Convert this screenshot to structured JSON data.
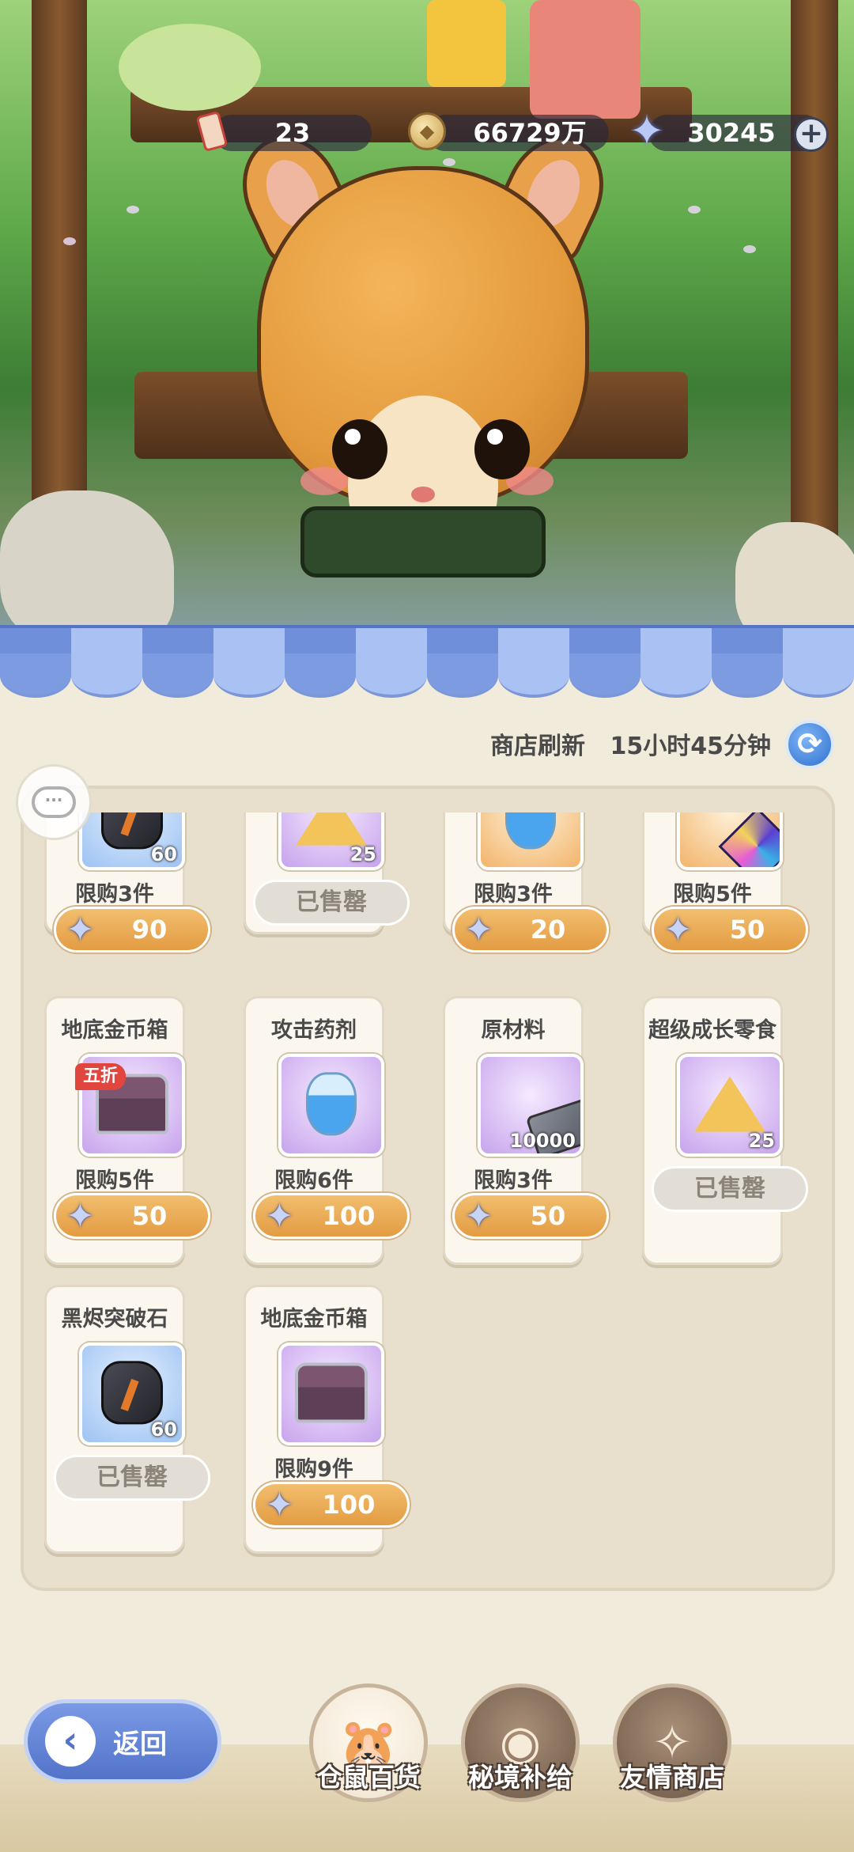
{
  "currencies": {
    "tickets": "23",
    "gold": "66729万",
    "stars": "30245",
    "add_icon": "plus-icon"
  },
  "shop": {
    "refresh_label": "商店刷新",
    "refresh_time": "15小时45分钟",
    "refresh_icon": "refresh-icon",
    "chat_icon": "chat-bubble-icon"
  },
  "items": [
    {
      "name": "",
      "icon": "black-ore-icon",
      "frame": "blue",
      "qty": "60",
      "limit": "限购3件",
      "price": "90",
      "sold_out": false
    },
    {
      "name": "",
      "icon": "cheese-icon",
      "frame": "purple",
      "qty": "25",
      "limit": "",
      "price": "",
      "sold_out": true,
      "sold_label": "已售罄"
    },
    {
      "name": "",
      "icon": "potion-icon",
      "frame": "orange",
      "qty": "",
      "limit": "限购3件",
      "price": "20",
      "sold_out": false
    },
    {
      "name": "",
      "icon": "gem-icon",
      "frame": "orange",
      "qty": "",
      "limit": "限购5件",
      "price": "50",
      "sold_out": false
    },
    {
      "name": "地底金币箱",
      "icon": "treasure-chest-icon",
      "frame": "purple",
      "qty": "",
      "badge": "五折",
      "limit": "限购5件",
      "price": "50",
      "sold_out": false
    },
    {
      "name": "攻击药剂",
      "icon": "potion-icon",
      "frame": "purple",
      "qty": "",
      "limit": "限购6件",
      "price": "100",
      "sold_out": false
    },
    {
      "name": "原材料",
      "icon": "ingot-icon",
      "frame": "purple",
      "qty": "10000",
      "limit": "限购3件",
      "price": "50",
      "sold_out": false
    },
    {
      "name": "超级成长零食",
      "icon": "cheese-icon",
      "frame": "purple",
      "qty": "25",
      "limit": "",
      "price": "",
      "sold_out": true,
      "sold_label": "已售罄"
    },
    {
      "name": "黑烬突破石",
      "icon": "black-ore-icon",
      "frame": "blue",
      "qty": "60",
      "limit": "",
      "price": "",
      "sold_out": true,
      "sold_label": "已售罄"
    },
    {
      "name": "地底金币箱",
      "icon": "treasure-chest-icon",
      "frame": "purple",
      "qty": "",
      "limit": "限购9件",
      "price": "100",
      "sold_out": false
    }
  ],
  "nav": {
    "back_label": "返回",
    "tabs": [
      {
        "label": "仓鼠百货",
        "icon": "hamster-icon",
        "active": true
      },
      {
        "label": "秘境补给",
        "icon": "eye-emblem-icon",
        "active": false
      },
      {
        "label": "友情商店",
        "icon": "crystal-ball-icon",
        "active": false
      }
    ]
  },
  "colors": {
    "price_button": "#e39c43",
    "awning_blue": "#7d9be0",
    "refresh_blue": "#2f6fd0"
  }
}
